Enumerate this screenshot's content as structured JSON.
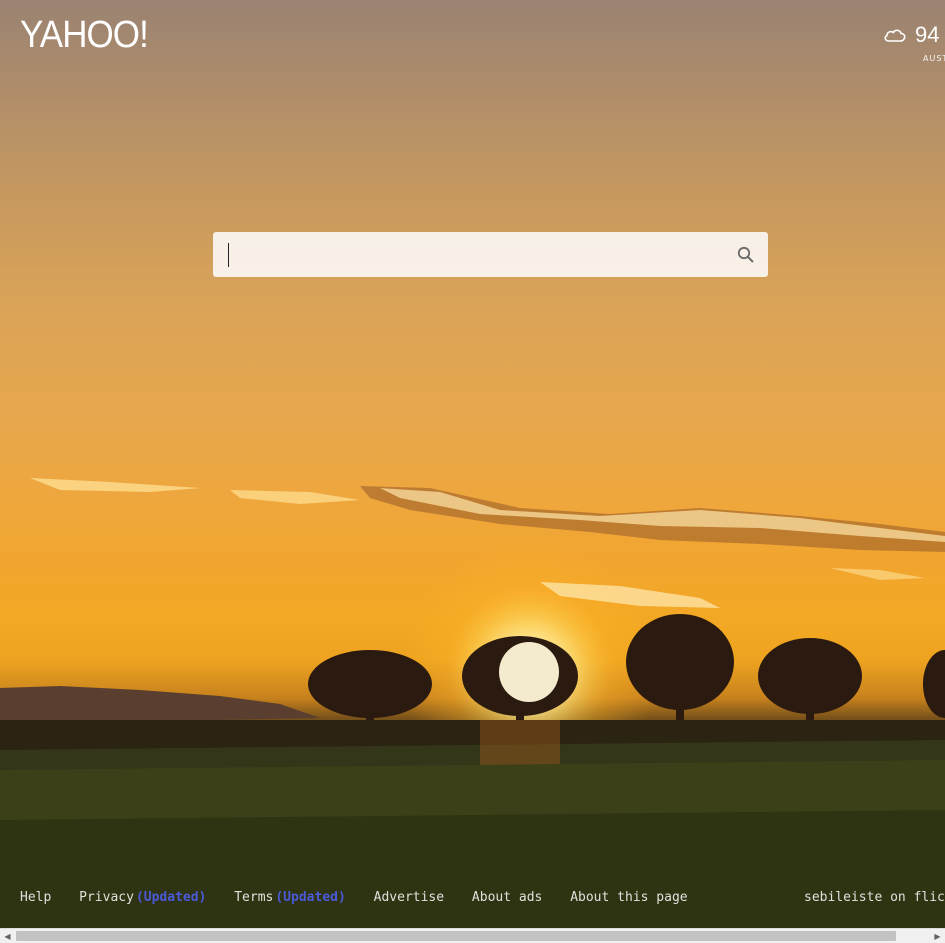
{
  "brand": {
    "logo_text": "YAHOO!"
  },
  "weather": {
    "icon": "cloud-icon",
    "temperature": "94",
    "location": "AUST"
  },
  "search": {
    "value": "",
    "placeholder": "",
    "button_icon": "search-icon"
  },
  "footer": {
    "links": [
      {
        "label": "Help"
      },
      {
        "label": "Privacy",
        "badge": "(Updated)"
      },
      {
        "label": "Terms",
        "badge": "(Updated)"
      },
      {
        "label": "Advertise"
      },
      {
        "label": "About ads"
      },
      {
        "label": "About this page"
      }
    ],
    "photo_credit": "sebileiste on flic"
  },
  "colors": {
    "badge": "#4a5ad8",
    "text": "#ffffff"
  }
}
